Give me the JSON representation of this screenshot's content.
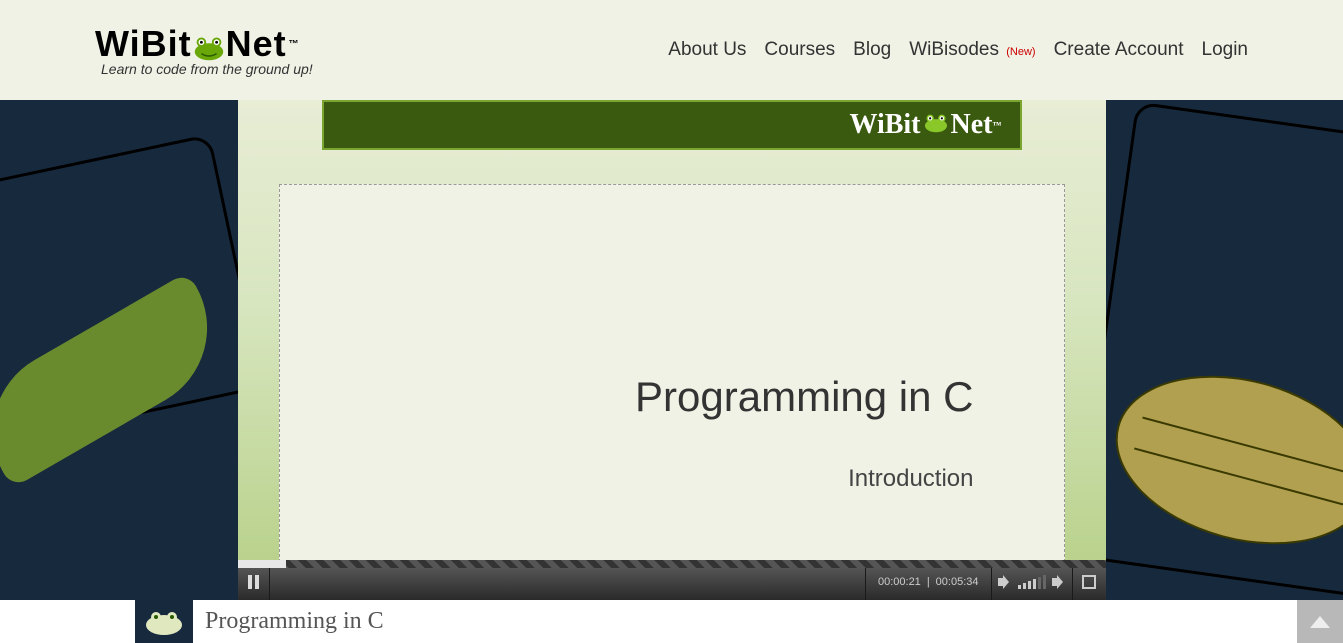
{
  "logo": {
    "left": "WiBit",
    "right": "Net",
    "tm": "™",
    "tagline": "Learn to code from the ground up!"
  },
  "nav": {
    "about": "About Us",
    "courses": "Courses",
    "blog": "Blog",
    "wibisodes": "WiBisodes",
    "wibisodes_new": "(New)",
    "create": "Create Account",
    "login": "Login"
  },
  "video": {
    "banner_left": "WiBit",
    "banner_right": "Net",
    "banner_tm": "™",
    "slide_title": "Programming in C",
    "slide_sub": "Introduction",
    "time_current": "00:00:21",
    "time_sep": "|",
    "time_total": "00:05:34"
  },
  "course": {
    "title": "Programming in C"
  }
}
